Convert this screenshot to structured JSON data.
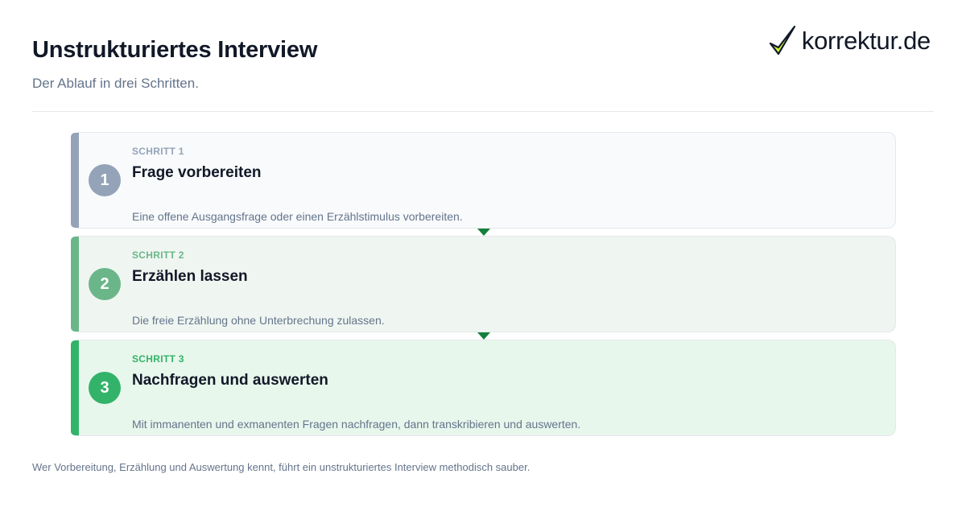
{
  "header": {
    "title": "Unstrukturiertes Interview",
    "subtitle": "Der Ablauf in drei Schritten."
  },
  "logo": {
    "icon": "checkmark-icon",
    "text": "korrektur.de"
  },
  "steps": [
    {
      "number": "1",
      "label": "SCHRITT 1",
      "heading": "Frage vorbereiten",
      "description": "Eine offene Ausgangsfrage oder einen Erzählstimulus vorbereiten.",
      "accent": "#94a3b8"
    },
    {
      "number": "2",
      "label": "SCHRITT 2",
      "heading": "Erzählen lassen",
      "description": "Die freie Erzählung ohne Unterbrechung zulassen.",
      "accent": "#6bb689"
    },
    {
      "number": "3",
      "label": "SCHRITT 3",
      "heading": "Nachfragen und auswerten",
      "description": "Mit immanenten und exmanenten Fragen nachfragen, dann transkribieren und auswerten.",
      "accent": "#33b36a"
    }
  ],
  "footer": {
    "text": "Wer Vorbereitung, Erzählung und Auswertung kennt, führt ein unstrukturiertes Interview methodisch sauber."
  },
  "colors": {
    "connector_arrow": "#15803d",
    "title": "#111827",
    "muted_text": "#64748b"
  }
}
